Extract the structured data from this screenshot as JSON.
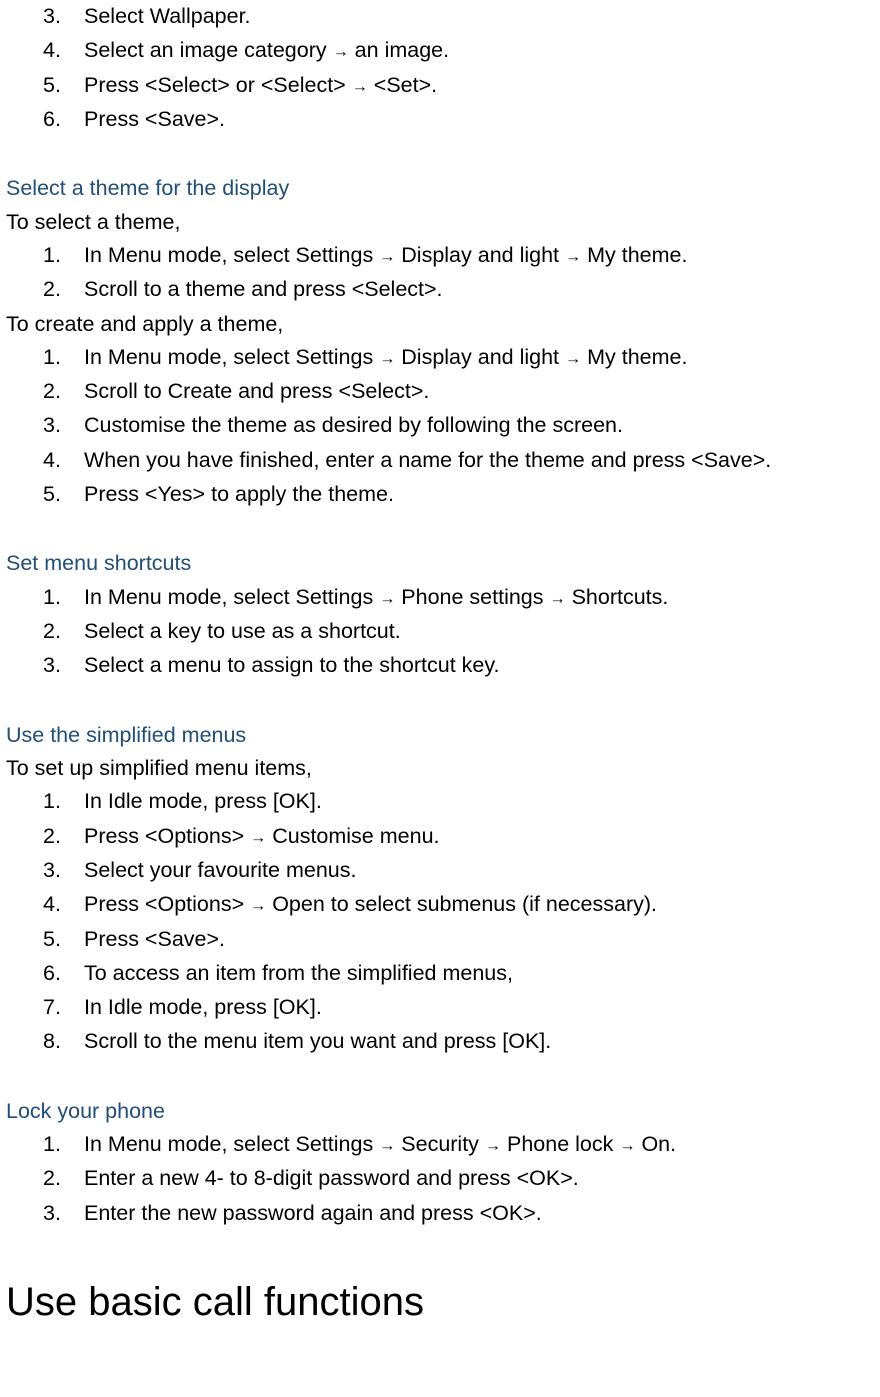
{
  "arrow": "→",
  "section0": {
    "items": [
      {
        "num": "3.",
        "text": "Select Wallpaper."
      },
      {
        "num": "4.",
        "parts": [
          "Select an image category ",
          " an image."
        ]
      },
      {
        "num": "5.",
        "parts": [
          "Press <Select> or <Select> ",
          " <Set>."
        ]
      },
      {
        "num": "6.",
        "text": "Press <Save>."
      }
    ]
  },
  "section1": {
    "heading": "Select a theme for the display",
    "intro1": "To select a theme,",
    "list1": [
      {
        "num": "1.",
        "parts": [
          "In Menu mode, select Settings ",
          " Display and light ",
          " My theme."
        ]
      },
      {
        "num": "2.",
        "text": "Scroll to a theme and press <Select>."
      }
    ],
    "intro2": "To create and apply a theme,",
    "list2": [
      {
        "num": "1.",
        "parts": [
          "In Menu mode, select Settings ",
          " Display and light ",
          " My theme."
        ]
      },
      {
        "num": "2.",
        "text": "Scroll to Create and press <Select>."
      },
      {
        "num": "3.",
        "text": "Customise the theme as desired by following the screen."
      },
      {
        "num": "4.",
        "text": "When you have finished, enter a name for the theme and press <Save>."
      },
      {
        "num": "5.",
        "text": "Press <Yes> to apply the theme."
      }
    ]
  },
  "section2": {
    "heading": "Set menu shortcuts",
    "list": [
      {
        "num": "1.",
        "parts": [
          "In Menu mode, select Settings ",
          " Phone settings ",
          " Shortcuts."
        ]
      },
      {
        "num": "2.",
        "text": "Select a key to use as a shortcut."
      },
      {
        "num": "3.",
        "text": "Select a menu to assign to the shortcut key."
      }
    ]
  },
  "section3": {
    "heading": "Use the simplified menus",
    "intro": "To set up simplified menu items,",
    "list": [
      {
        "num": "1.",
        "text": "In Idle mode, press [OK]."
      },
      {
        "num": "2.",
        "parts": [
          "Press <Options> ",
          " Customise menu."
        ]
      },
      {
        "num": "3.",
        "text": "Select your favourite menus."
      },
      {
        "num": "4.",
        "parts": [
          "Press <Options> ",
          " Open to select submenus (if necessary)."
        ]
      },
      {
        "num": "5.",
        "text": "Press <Save>."
      },
      {
        "num": "6.",
        "text": "To access an item from the simplified menus,"
      },
      {
        "num": "7.",
        "text": "In Idle mode, press [OK]."
      },
      {
        "num": "8.",
        "text": "Scroll to the menu item you want and press [OK]."
      }
    ]
  },
  "section4": {
    "heading": "Lock your phone",
    "list": [
      {
        "num": "1.",
        "parts": [
          "In Menu mode, select Settings ",
          " Security ",
          " Phone lock ",
          " On."
        ]
      },
      {
        "num": "2.",
        "text": "Enter a new 4- to 8-digit password and press <OK>."
      },
      {
        "num": "3.",
        "text": "Enter the new password again and press <OK>."
      }
    ]
  },
  "section5": {
    "heading": "Use basic call functions"
  }
}
